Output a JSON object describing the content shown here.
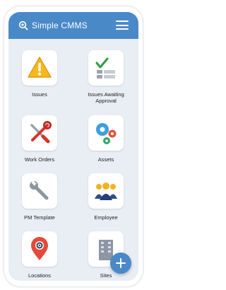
{
  "app": {
    "title": "Simple CMMS"
  },
  "colors": {
    "header": "#4a89c8",
    "background": "#e9edf4",
    "fab": "#4a89c8"
  },
  "tiles": [
    {
      "label": "Issues",
      "icon": "warning-triangle-icon"
    },
    {
      "label": "Issues Awaiting Approval",
      "icon": "approval-checklist-icon"
    },
    {
      "label": "Work Orders",
      "icon": "tools-wrench-screwdriver-icon"
    },
    {
      "label": "Assets",
      "icon": "gears-icon"
    },
    {
      "label": "PM Template",
      "icon": "wrench-icon"
    },
    {
      "label": "Employee",
      "icon": "people-group-icon"
    },
    {
      "label": "Locations",
      "icon": "location-pin-gear-icon"
    },
    {
      "label": "Sites",
      "icon": "building-icon"
    }
  ],
  "fab": {
    "icon": "plus-icon"
  }
}
